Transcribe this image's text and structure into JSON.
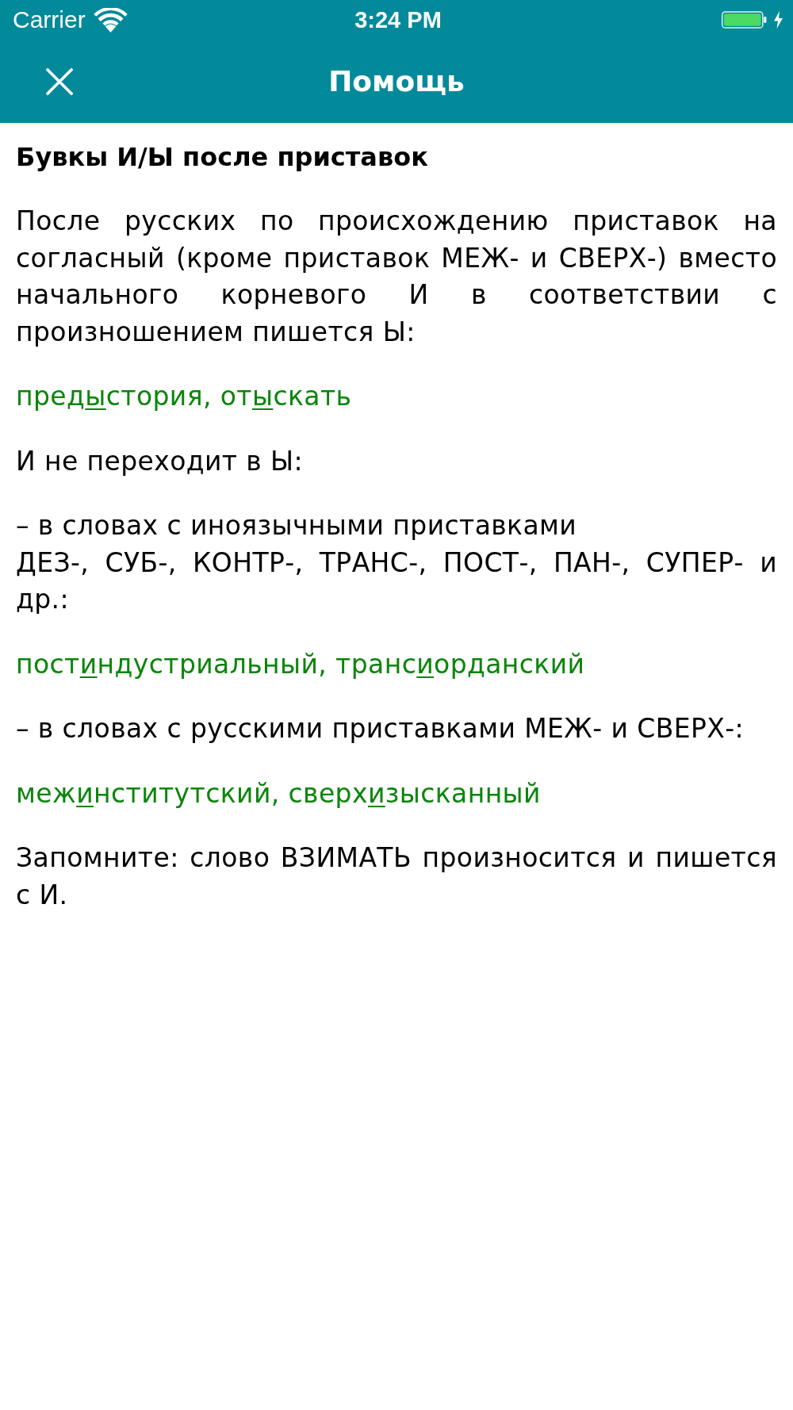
{
  "status_bar": {
    "carrier": "Carrier",
    "time": "3:24 PM"
  },
  "nav_bar": {
    "title": "Помощь"
  },
  "article": {
    "title": "Бувкы И/Ы после приставок",
    "blocks": [
      {
        "kind": "paragraph",
        "text": "После русских по происхождению приставок на согласный (кроме приставок МЕЖ- и СВЕРХ-) вместо начального корневого И в соответствии с произношением пишется Ы:"
      },
      {
        "kind": "example",
        "parts": [
          {
            "text": "пред",
            "underlined": false
          },
          {
            "text": "ы",
            "underlined": true
          },
          {
            "text": "стория, от",
            "underlined": false
          },
          {
            "text": "ы",
            "underlined": true
          },
          {
            "text": "скать",
            "underlined": false
          }
        ]
      },
      {
        "kind": "paragraph",
        "text": "И не переходит в Ы:"
      },
      {
        "kind": "paragraph",
        "text": "– в словах с иноязычными приставками\nДЕЗ-, СУБ-, КОНТР-, ТРАНС-, ПОСТ-, ПАН-, СУПЕР- и др.:"
      },
      {
        "kind": "example",
        "parts": [
          {
            "text": "пост",
            "underlined": false
          },
          {
            "text": "и",
            "underlined": true
          },
          {
            "text": "ндустриальный, транс",
            "underlined": false
          },
          {
            "text": "и",
            "underlined": true
          },
          {
            "text": "орданский",
            "underlined": false
          }
        ]
      },
      {
        "kind": "paragraph",
        "text": "– в словах с русскими приставками МЕЖ- и СВЕРХ-:"
      },
      {
        "kind": "example",
        "parts": [
          {
            "text": "меж",
            "underlined": false
          },
          {
            "text": "и",
            "underlined": true
          },
          {
            "text": "нститутский, сверх",
            "underlined": false
          },
          {
            "text": "и",
            "underlined": true
          },
          {
            "text": "зысканный",
            "underlined": false
          }
        ]
      },
      {
        "kind": "paragraph",
        "text": "Запомните: слово ВЗИМАТЬ произносится и пишется с И."
      }
    ]
  }
}
